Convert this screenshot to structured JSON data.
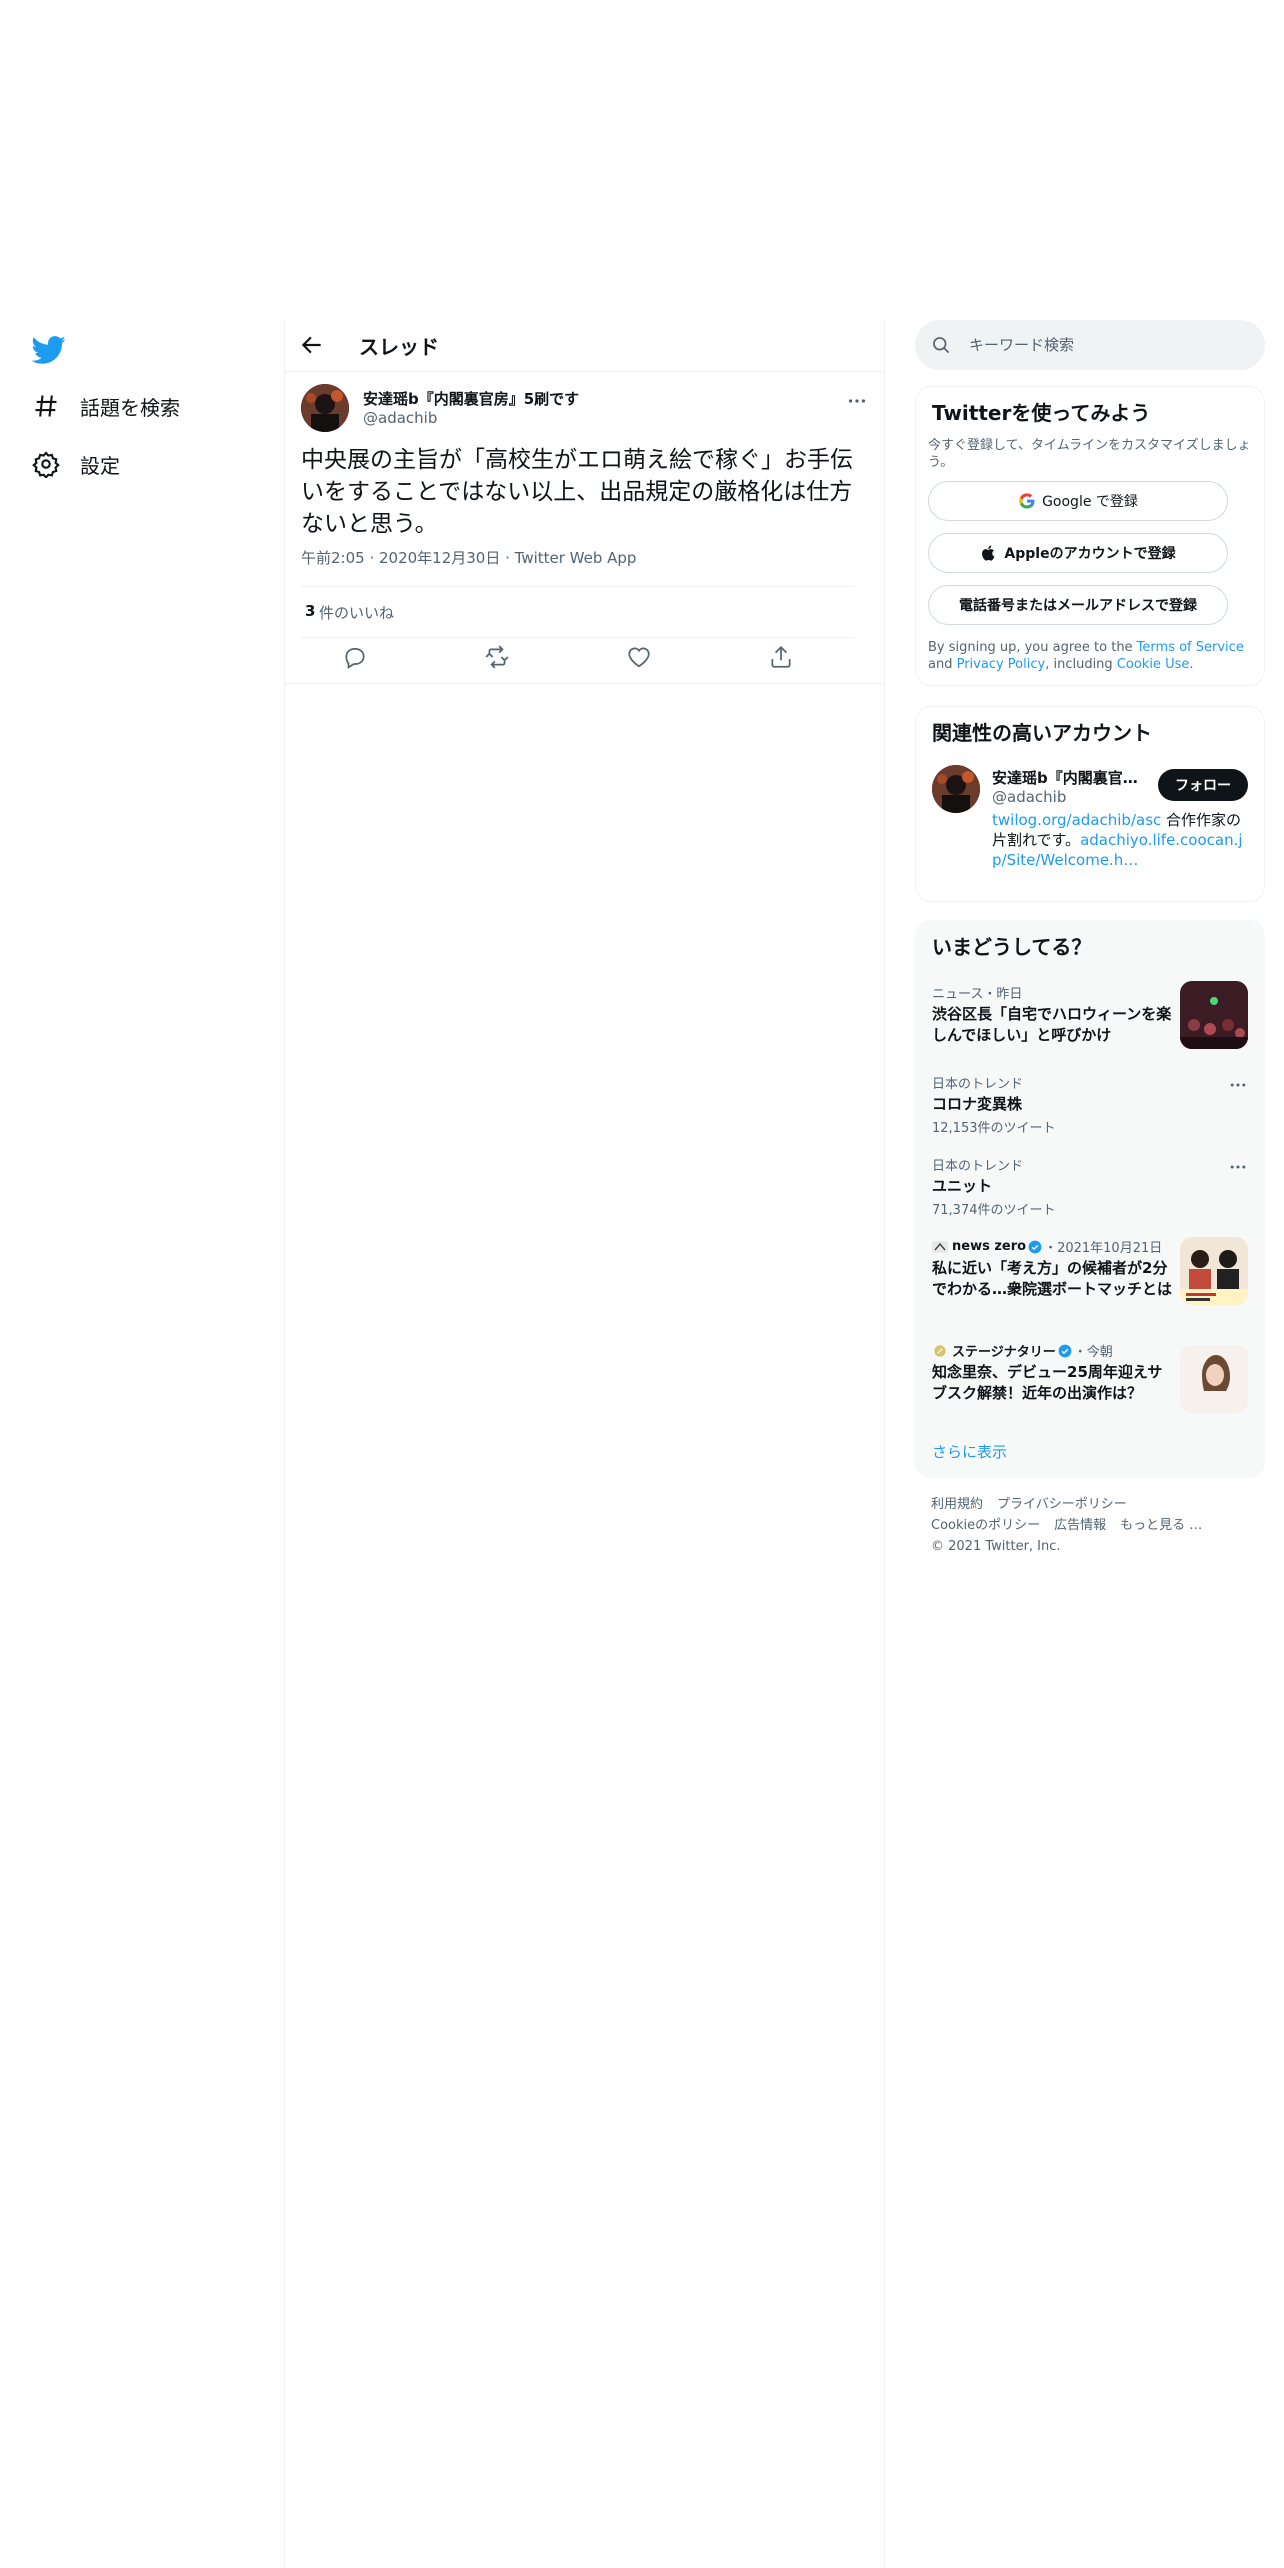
{
  "nav": {
    "explore_label": "話題を検索",
    "settings_label": "設定"
  },
  "thread": {
    "title": "スレッド"
  },
  "tweet": {
    "author_name": "安達瑶b『内閣裏官房』5刷です",
    "author_handle": "@adachib",
    "text": "中央展の主旨が「高校生がエロ萌え絵で稼ぐ」お手伝いをすることではない以上、出品規定の厳格化は仕方ないと思う。",
    "meta": "午前2:05 · 2020年12月30日 · Twitter Web App",
    "likes_count": "3",
    "likes_label": "件のいいね"
  },
  "search": {
    "placeholder": "キーワード検索"
  },
  "signup": {
    "title": "Twitterを使ってみよう",
    "subtitle": "今すぐ登録して、タイムラインをカスタマイズしましょう。",
    "google_label": "Google で登録",
    "apple_label": "Appleのアカウントで登録",
    "phone_label": "電話番号またはメールアドレスで登録",
    "legal_prefix": "By signing up, you agree to the ",
    "terms_link": "Terms of Service",
    "legal_and": " and ",
    "privacy_link": "Privacy Policy",
    "legal_including": ", including ",
    "cookie_link": "Cookie Use",
    "legal_end": "."
  },
  "related": {
    "title": "関連性の高いアカウント",
    "name": "安達瑶b『内閣裏官房』5刷です",
    "handle": "@adachib",
    "follow_label": "フォロー",
    "bio_link1": "twilog.org/adachib/asc",
    "bio_text": " 合作作家の片割れです。",
    "bio_link2": "adachiyo.life.coocan.jp/Site/Welcome.h…"
  },
  "trends": {
    "title": "いまどうしてる？",
    "items": [
      {
        "meta": "ニュース・昨日",
        "title": "渋谷区長「自宅でハロウィーンを楽しんでほしい」と呼びかけ"
      },
      {
        "meta": "日本のトレンド",
        "title": "コロナ変異株",
        "count": "12,153件のツイート"
      },
      {
        "meta": "日本のトレンド",
        "title": "ユニット",
        "count": "71,374件のツイート"
      },
      {
        "source": "news zero",
        "time": "・2021年10月21日",
        "title": "私に近い「考え方」の候補者が2分でわかる…衆院選ボートマッチとは"
      },
      {
        "source": "ステージナタリー",
        "time": "・今朝",
        "title": "知念里奈、デビュー25周年迎えサブスク解禁！近年の出演作は？"
      }
    ],
    "show_more": "さらに表示"
  },
  "footer": {
    "terms": "利用規約",
    "privacy": "プライバシーポリシー",
    "cookie": "Cookieのポリシー",
    "ads": "広告情報",
    "more": "もっと見る …",
    "copyright": "© 2021 Twitter, Inc."
  },
  "colors": {
    "accent": "#1d9bf0",
    "text": "#0f1419",
    "secondary": "#536471",
    "border": "#eff3f4"
  }
}
